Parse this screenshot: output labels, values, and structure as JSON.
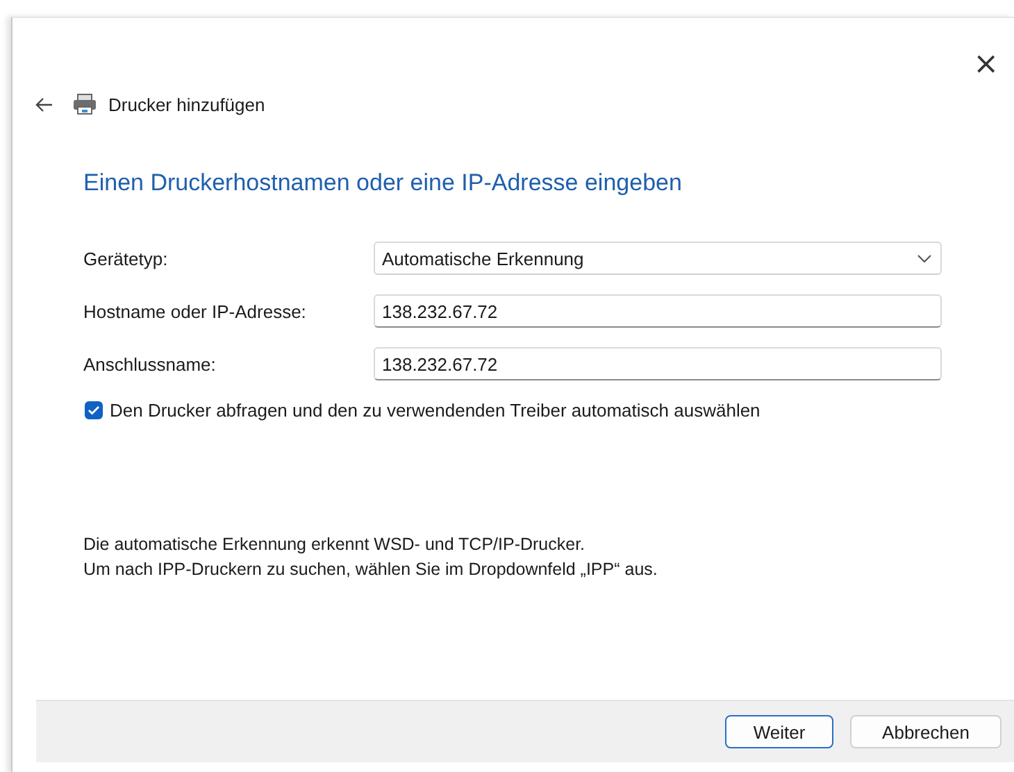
{
  "window": {
    "title": "Drucker hinzufügen",
    "close": "×"
  },
  "heading": "Einen Druckerhostnamen oder eine IP-Adresse eingeben",
  "fields": [
    {
      "kind": "dropdown",
      "label": "Gerätetyp:",
      "value": "Automatische Erkennung"
    },
    {
      "kind": "text",
      "label": "Hostname oder IP-Adresse:",
      "value": "138.232.67.72"
    },
    {
      "kind": "text",
      "label": "Anschlussname:",
      "value": "138.232.67.72"
    }
  ],
  "checkbox": {
    "label": "Den Drucker abfragen und den zu verwendenden Treiber automatisch auswählen",
    "checked": true
  },
  "info": [
    "Die automatische Erkennung erkennt WSD- und TCP/IP-Drucker.",
    "Um nach IPP-Druckern zu suchen, wählen Sie im Dropdownfeld „IPP“ aus."
  ],
  "buttons": [
    {
      "label": "Weiter",
      "default": true
    },
    {
      "label": "Abbrechen",
      "default": false
    }
  ]
}
